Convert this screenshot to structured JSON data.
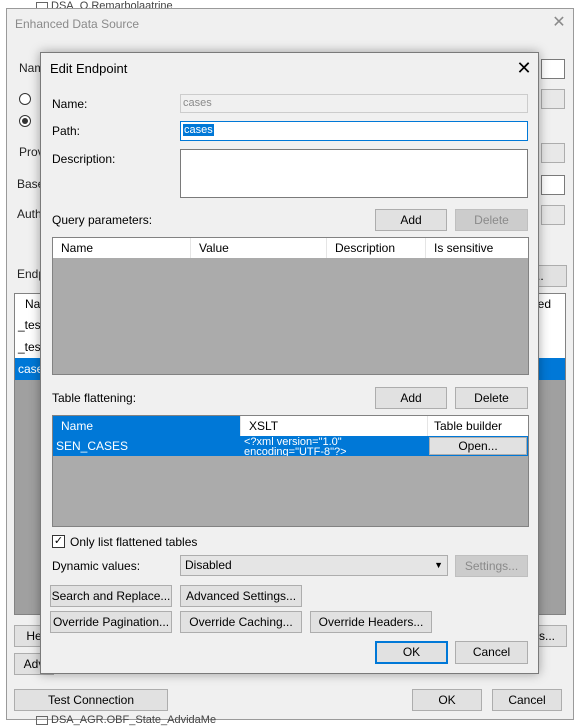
{
  "background_window": {
    "tree_top": "DSA_Q.Remarbolaatrine",
    "title": "Enhanced Data Source",
    "label_name": "Nam",
    "label_provider": "Prov",
    "label_base": "Base",
    "label_auth": "Auth",
    "label_endpoints": "Endp",
    "list_header_name": "Nar",
    "list_header_enabled": "led",
    "list_rows": [
      "_test",
      "_test",
      "case"
    ],
    "button_r": "r...",
    "button_he": "He",
    "button_s": "s...",
    "button_adv": "Adv",
    "test_connection": "Test Connection",
    "ok": "OK",
    "cancel": "Cancel",
    "tree_bottom": "DSA_AGR.OBF_State_AdvidaMe"
  },
  "dialog": {
    "title": "Edit Endpoint",
    "name_label": "Name:",
    "name_value": "cases",
    "path_label": "Path:",
    "path_value": "cases",
    "description_label": "Description:",
    "description_value": "",
    "query_parameters_label": "Query parameters:",
    "qp_add": "Add",
    "qp_delete": "Delete",
    "qp_columns": [
      "Name",
      "Value",
      "Description",
      "Is sensitive"
    ],
    "table_flattening_label": "Table flattening:",
    "tf_add": "Add",
    "tf_delete": "Delete",
    "tf_columns": [
      "Name",
      "XSLT",
      "Table builder"
    ],
    "tf_rows": [
      {
        "name": "SEN_CASES",
        "xslt_line1": "<?xml version=\"1.0\"",
        "xslt_line2": "encoding=\"UTF-8\"?>",
        "builder": "Open..."
      }
    ],
    "only_flattened_label": "Only list flattened tables",
    "only_flattened_checked": "✓",
    "dynamic_values_label": "Dynamic values:",
    "dynamic_values_selected": "Disabled",
    "settings_button": "Settings...",
    "search_replace_button": "Search and Replace...",
    "advanced_settings_button": "Advanced Settings...",
    "override_pagination_button": "Override Pagination...",
    "override_caching_button": "Override Caching...",
    "override_headers_button": "Override Headers...",
    "ok": "OK",
    "cancel": "Cancel"
  },
  "colors": {
    "accent": "#0078d7",
    "grid_empty": "#ababab",
    "dialog_bg": "#f0f0f0"
  },
  "icons": {
    "close": "close-icon",
    "dropdown": "chevron-down-icon",
    "check": "checkmark-icon"
  }
}
